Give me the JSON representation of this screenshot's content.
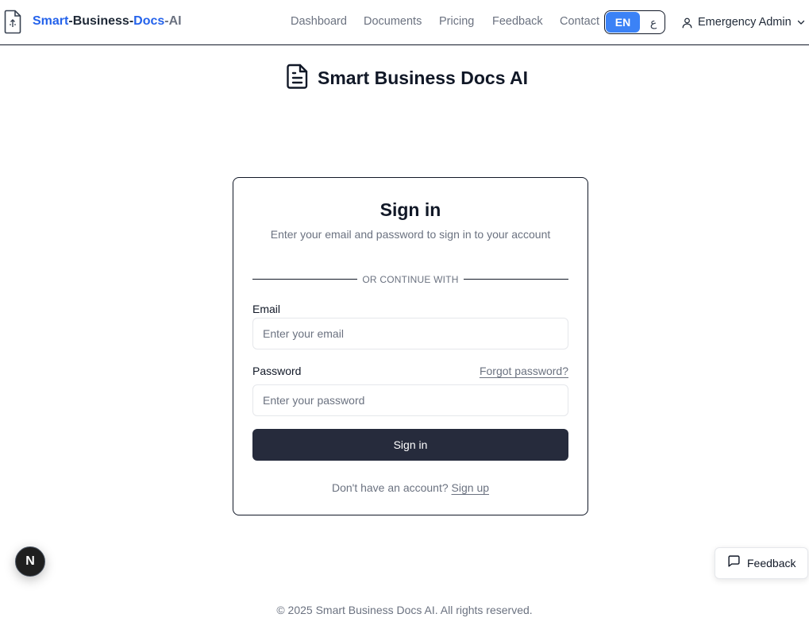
{
  "header": {
    "brand": {
      "part1": "Smart",
      "sep1": "-",
      "part2": "Business",
      "sep2": "-",
      "part3": "Docs",
      "sep3": "-",
      "part4": "AI"
    },
    "nav": [
      {
        "label": "Dashboard"
      },
      {
        "label": "Documents"
      },
      {
        "label": "Pricing"
      },
      {
        "label": "Feedback"
      },
      {
        "label": "Contact"
      }
    ],
    "language": {
      "en": "EN",
      "ar": "ع",
      "active": "EN"
    },
    "user": {
      "name": "Emergency Admin",
      "icon": "user-icon",
      "caret": "chevron-down-icon"
    }
  },
  "page": {
    "title": "Smart Business Docs AI",
    "title_icon": "document-icon"
  },
  "signin": {
    "title": "Sign in",
    "subtitle": "Enter your email and password to sign in to your account",
    "divider": "OR CONTINUE WITH",
    "email_label": "Email",
    "email_placeholder": "Enter your email",
    "email_value": "",
    "password_label": "Password",
    "forgot": "Forgot password?",
    "password_placeholder": "Enter your password",
    "password_value": "",
    "button": "Sign in",
    "no_account": "Don't have an account?",
    "signup": "Sign up"
  },
  "floating": {
    "next_badge": "N",
    "feedback": "Feedback",
    "feedback_icon": "message-square-icon"
  },
  "footer": {
    "text": "© 2025 Smart Business Docs AI. All rights reserved."
  },
  "colors": {
    "brand_blue": "#2563eb",
    "lang_active": "#3b82f6",
    "primary_button": "#262b3c",
    "muted_text": "#6b7280"
  }
}
